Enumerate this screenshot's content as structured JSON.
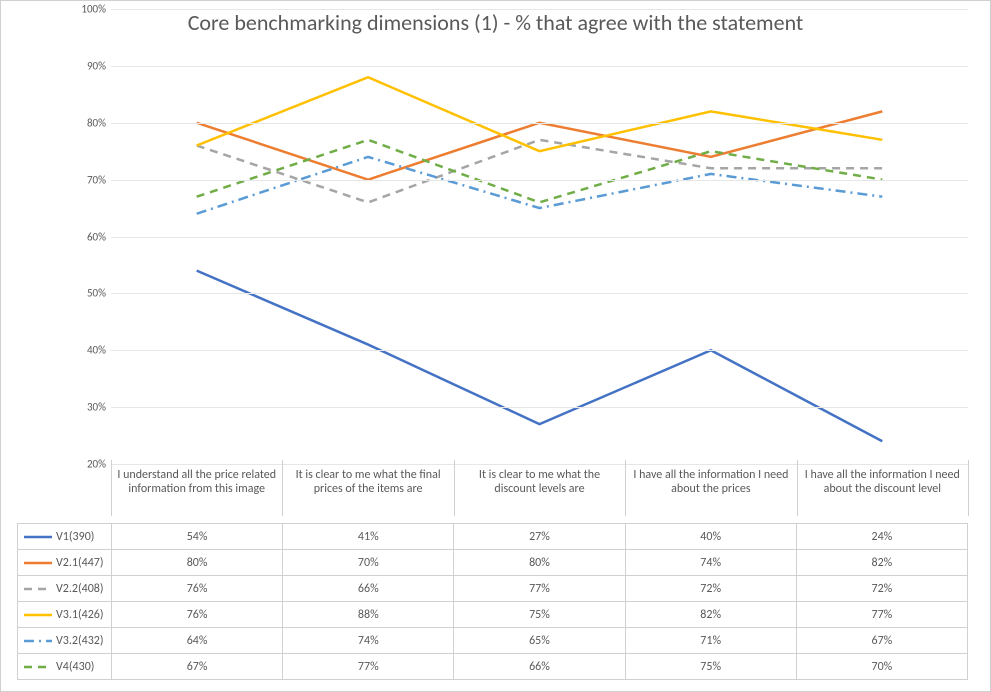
{
  "chart_data": {
    "type": "line",
    "title": "Core benchmarking dimensions (1) - % that agree with the statement",
    "ylabel": "",
    "xlabel": "",
    "ylim": [
      20,
      100
    ],
    "yticks": [
      20,
      30,
      40,
      50,
      60,
      70,
      80,
      90,
      100
    ],
    "ytick_labels": [
      "20%",
      "30%",
      "40%",
      "50%",
      "60%",
      "70%",
      "80%",
      "90%",
      "100%"
    ],
    "categories": [
      "I understand all the price related information from this image",
      "It is clear to me what the final prices of the items are",
      "It is clear to me what the discount levels are",
      "I have all the information I need about the prices",
      "I have all the information I need about the discount level"
    ],
    "series": [
      {
        "name": "V1(390)",
        "values": [
          54,
          41,
          27,
          40,
          24
        ],
        "color": "#4472C4",
        "dash": "solid",
        "display": [
          "54%",
          "41%",
          "27%",
          "40%",
          "24%"
        ]
      },
      {
        "name": "V2.1(447)",
        "values": [
          80,
          70,
          80,
          74,
          82
        ],
        "color": "#ED7D31",
        "dash": "solid",
        "display": [
          "80%",
          "70%",
          "80%",
          "74%",
          "82%"
        ]
      },
      {
        "name": "V2.2(408)",
        "values": [
          76,
          66,
          77,
          72,
          72
        ],
        "color": "#A5A5A5",
        "dash": "dashed",
        "display": [
          "76%",
          "66%",
          "77%",
          "72%",
          "72%"
        ]
      },
      {
        "name": "V3.1(426)",
        "values": [
          76,
          88,
          75,
          82,
          77
        ],
        "color": "#FFC000",
        "dash": "solid",
        "display": [
          "76%",
          "88%",
          "75%",
          "82%",
          "77%"
        ]
      },
      {
        "name": "V3.2(432)",
        "values": [
          64,
          74,
          65,
          71,
          67
        ],
        "color": "#5B9BD5",
        "dash": "dashdot",
        "display": [
          "64%",
          "74%",
          "65%",
          "71%",
          "67%"
        ]
      },
      {
        "name": "V4(430)",
        "values": [
          67,
          77,
          66,
          75,
          70
        ],
        "color": "#70AD47",
        "dash": "dashed",
        "display": [
          "67%",
          "77%",
          "66%",
          "75%",
          "70%"
        ]
      }
    ]
  }
}
